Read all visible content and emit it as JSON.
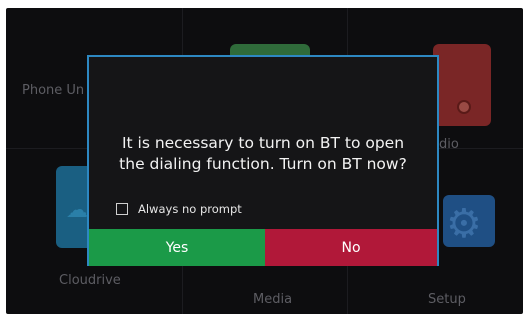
{
  "background": {
    "apps": [
      {
        "label": "Phone Un"
      },
      {
        "label": "dio"
      },
      {
        "label": "Cloudrive"
      },
      {
        "label": "Media"
      },
      {
        "label": "Setup"
      }
    ]
  },
  "dialog": {
    "message_line1": "It is necessary to turn on BT to open",
    "message_line2": "the dialing function. Turn on BT now?",
    "checkbox_label": "Always no prompt",
    "checkbox_checked": false,
    "yes_label": "Yes",
    "no_label": "No"
  },
  "colors": {
    "screen_bg": "#0d0d0f",
    "dialog_border": "#2d88c2",
    "yes_button": "#1b9a48",
    "no_button": "#b11839"
  },
  "icons": [
    "gear-icon",
    "cloud-icon",
    "checkbox-icon"
  ]
}
